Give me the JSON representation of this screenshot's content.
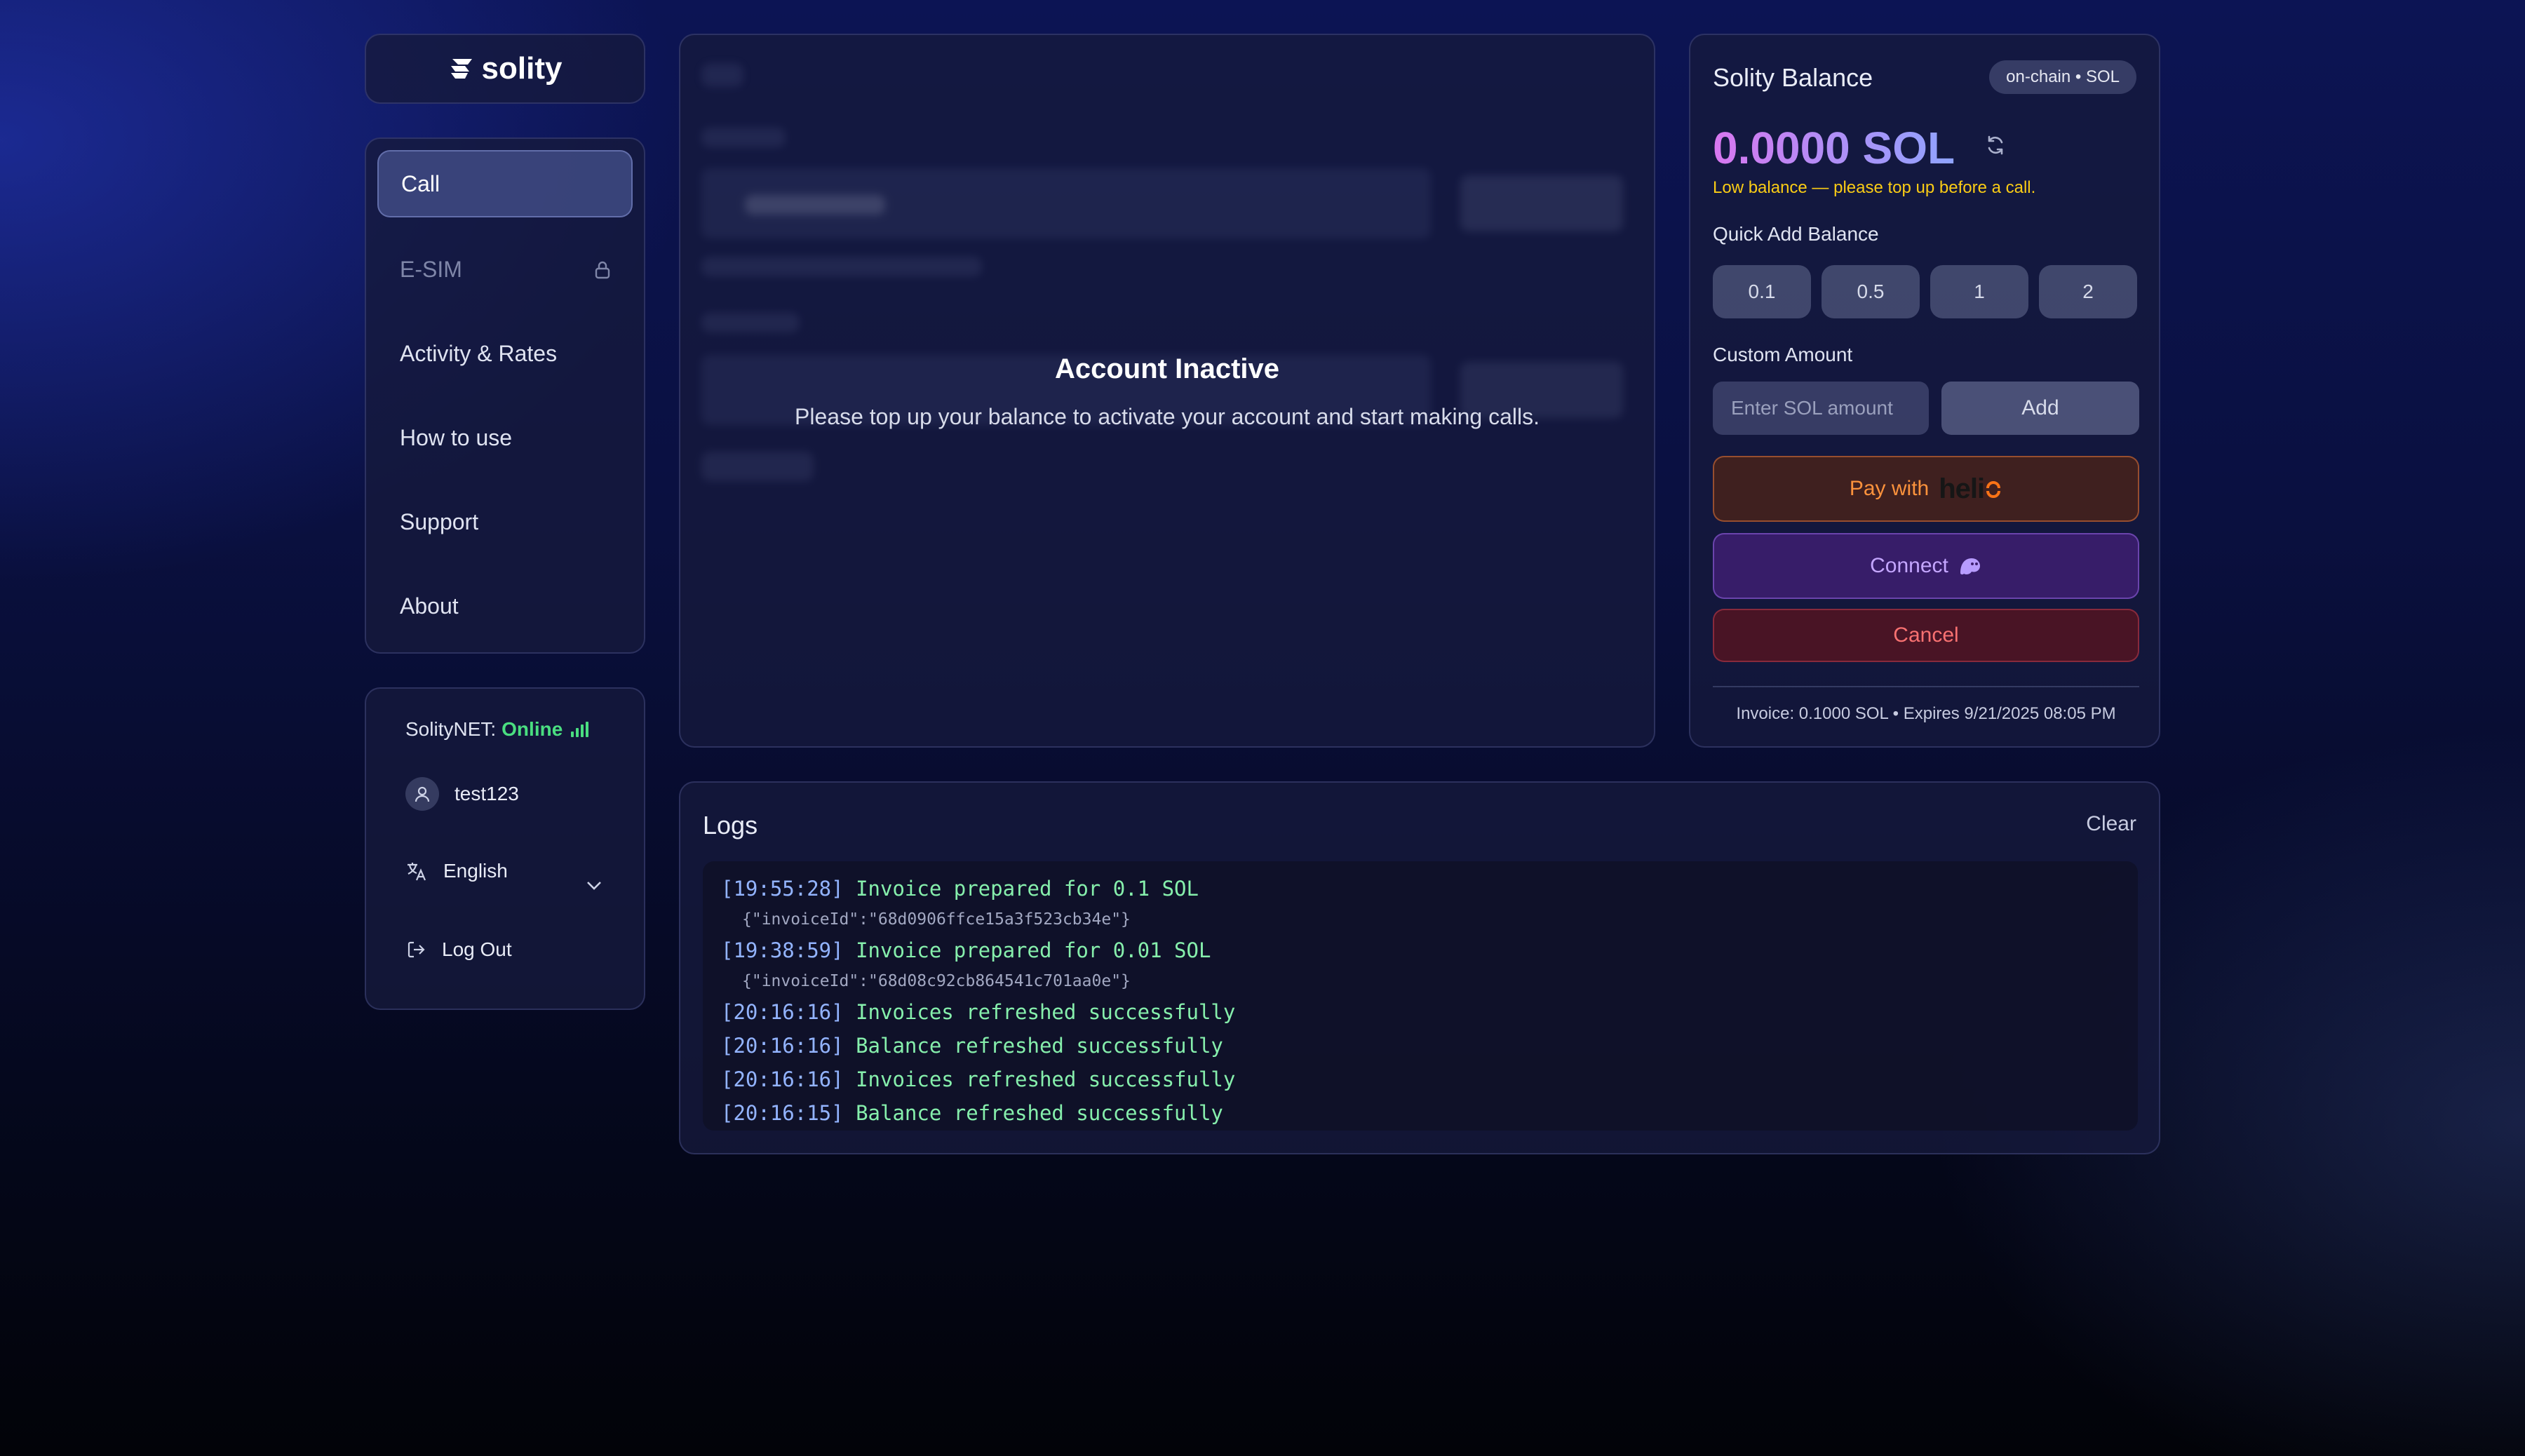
{
  "logo": {
    "text": "solity"
  },
  "sidebar": {
    "items": [
      {
        "label": "Call",
        "active": true
      },
      {
        "label": "E-SIM",
        "locked": true
      },
      {
        "label": "Activity & Rates"
      },
      {
        "label": "How to use"
      },
      {
        "label": "Support"
      },
      {
        "label": "About"
      }
    ]
  },
  "status": {
    "network_label": "SolityNET:",
    "network_state": "Online",
    "username": "test123",
    "language": "English",
    "logout_label": "Log Out"
  },
  "main": {
    "overlay_title": "Account Inactive",
    "overlay_message": "Please top up your balance to activate your account and start making calls."
  },
  "balance": {
    "title": "Solity Balance",
    "network_badge": "on-chain • SOL",
    "amount": "0.0000 SOL",
    "warning": "Low balance — please top up before a call.",
    "quick_add_label": "Quick Add Balance",
    "quick_amounts": [
      "0.1",
      "0.5",
      "1",
      "2"
    ],
    "custom_label": "Custom Amount",
    "custom_placeholder": "Enter SOL amount",
    "add_label": "Add",
    "pay_label": "Pay with",
    "pay_brand": "heli",
    "connect_label": "Connect",
    "cancel_label": "Cancel",
    "invoice_text": "Invoice: 0.1000 SOL • Expires 9/21/2025 08:05 PM"
  },
  "logs": {
    "title": "Logs",
    "clear_label": "Clear",
    "entries": [
      {
        "time": "[19:55:28]",
        "message": "Invoice prepared for 0.1 SOL",
        "detail": "{\"invoiceId\":\"68d0906ffce15a3f523cb34e\"}"
      },
      {
        "time": "[19:38:59]",
        "message": "Invoice prepared for 0.01 SOL",
        "detail": "{\"invoiceId\":\"68d08c92cb864541c701aa0e\"}"
      },
      {
        "time": "[20:16:16]",
        "message": "Invoices refreshed successfully"
      },
      {
        "time": "[20:16:16]",
        "message": "Balance refreshed successfully"
      },
      {
        "time": "[20:16:16]",
        "message": "Invoices refreshed successfully"
      },
      {
        "time": "[20:16:15]",
        "message": "Balance refreshed successfully"
      }
    ]
  },
  "colors": {
    "accent_online": "#4ade80",
    "warning": "#facc15",
    "pay_orange": "#fb923c",
    "connect_purple": "#c4a6ff",
    "cancel_red": "#f87171",
    "log_time": "#93b4ff",
    "log_message": "#86efac"
  },
  "icons": {
    "logo": "solity-logo-icon",
    "lock": "lock-icon",
    "signal": "signal-bars-icon",
    "user": "user-icon",
    "language": "translate-icon",
    "chevron": "chevron-down-icon",
    "logout": "logout-icon",
    "refresh": "refresh-icon",
    "phantom": "phantom-ghost-icon"
  }
}
